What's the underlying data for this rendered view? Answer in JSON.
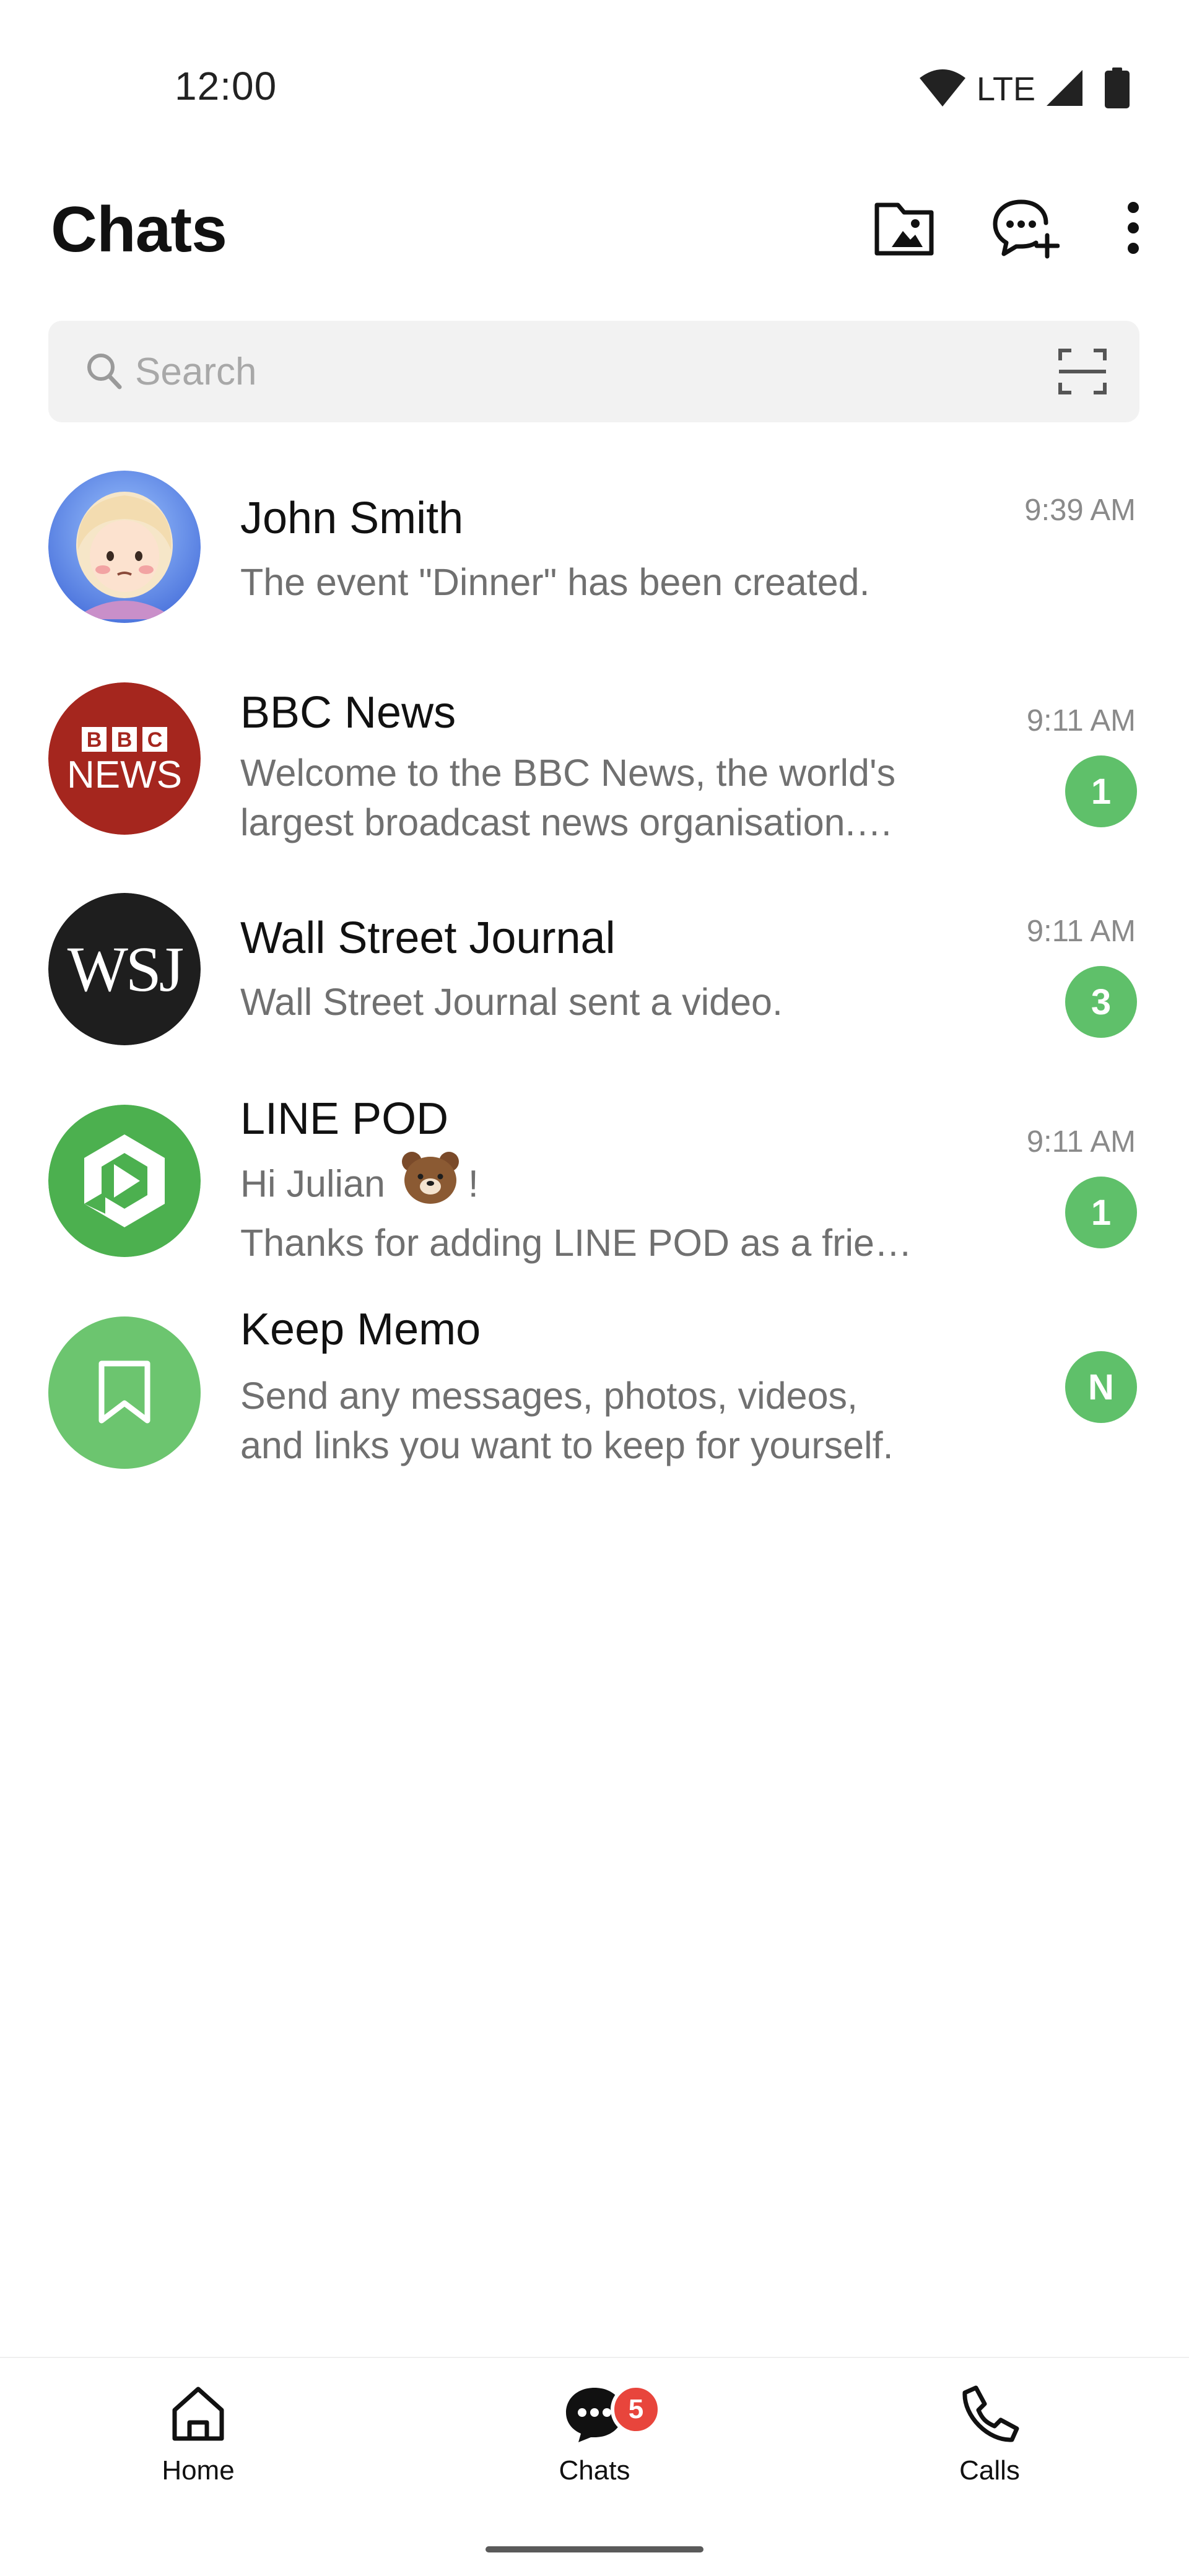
{
  "status_bar": {
    "time": "12:00",
    "network": "LTE",
    "icons": [
      "wifi-icon",
      "cellular-signal-icon",
      "battery-icon"
    ]
  },
  "header": {
    "title": "Chats",
    "actions": [
      "chat-folder-icon",
      "new-chat-icon",
      "more-options-icon"
    ]
  },
  "search": {
    "placeholder": "Search",
    "value": "",
    "icons": [
      "search-icon",
      "scan-icon"
    ]
  },
  "chats": [
    {
      "name": "John Smith",
      "preview": [
        "The event \"Dinner\" has been created."
      ],
      "time": "9:39 AM",
      "unread": ""
    },
    {
      "name": "BBC News",
      "preview": [
        "Welcome to the BBC News, the world's",
        "largest broadcast news organisation.…"
      ],
      "time": "9:11 AM",
      "unread": "1",
      "avatar_text": [
        "BBC",
        "NEWS"
      ]
    },
    {
      "name": "Wall Street Journal",
      "preview": [
        "Wall Street Journal sent a video."
      ],
      "time": "9:11 AM",
      "unread": "3",
      "avatar_text": "WSJ"
    },
    {
      "name": "LINE POD",
      "preview": [
        "Hi Julian",
        "!",
        "Thanks for adding LINE POD as a frie…"
      ],
      "time": "9:11 AM",
      "unread": "1"
    },
    {
      "name": "Keep Memo",
      "preview": [
        "Send any messages, photos, videos,",
        "and links you want to keep for yourself."
      ],
      "time": "",
      "unread": "N"
    }
  ],
  "bottom_nav": {
    "items": [
      {
        "label": "Home",
        "icon": "home-icon"
      },
      {
        "label": "Chats",
        "icon": "chats-icon",
        "badge": "5"
      },
      {
        "label": "Calls",
        "icon": "phone-icon"
      }
    ]
  },
  "colors": {
    "accent_green": "#5fc06a",
    "badge_red": "#e8453c",
    "bbc_red": "#a5261e",
    "line_green": "#4cb04f"
  }
}
